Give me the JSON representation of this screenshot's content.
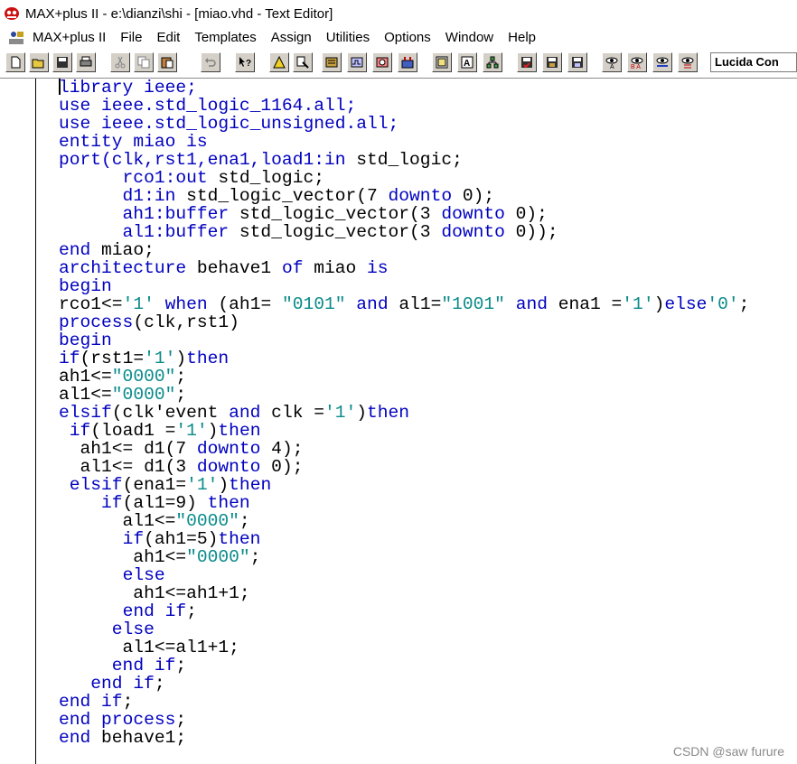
{
  "window": {
    "title": "MAX+plus II - e:\\dianzi\\shi - [miao.vhd - Text Editor]"
  },
  "menu": [
    "MAX+plus II",
    "File",
    "Edit",
    "Templates",
    "Assign",
    "Utilities",
    "Options",
    "Window",
    "Help"
  ],
  "toolbar": {
    "buttons": [
      "new-icon",
      "open-icon",
      "save-icon",
      "print-icon",
      "cut-icon",
      "copy-icon",
      "paste-icon",
      "undo-icon",
      "help-pointer-icon",
      "warning-icon",
      "hierarchy-icon",
      "compile-icon",
      "simulate-icon",
      "timing-icon",
      "program-icon",
      "floorplan-icon",
      "project-icon",
      "top-level-icon",
      "symbol-icon",
      "save-check-icon",
      "save-compile-icon",
      "save-simulate-icon",
      "find-icon",
      "replace-icon",
      "find-next-icon",
      "find-prev-icon"
    ],
    "font": "Lucida Con"
  },
  "editor": {
    "lines": [
      [
        {
          "t": "library ieee;",
          "c": "kw"
        }
      ],
      [
        {
          "t": "use",
          "c": "kw"
        },
        {
          "t": " ieee.std_logic_1164.",
          "c": "kw"
        },
        {
          "t": "all",
          "c": "kw"
        },
        {
          "t": ";",
          "c": "kw"
        }
      ],
      [
        {
          "t": "use",
          "c": "kw"
        },
        {
          "t": " ieee.std_logic_unsigned.",
          "c": "kw"
        },
        {
          "t": "all",
          "c": "kw"
        },
        {
          "t": ";",
          "c": "kw"
        }
      ],
      [
        {
          "t": "entity",
          "c": "kw"
        },
        {
          "t": " miao ",
          "c": "kw"
        },
        {
          "t": "is",
          "c": "kw"
        }
      ],
      [
        {
          "t": "port",
          "c": "kw"
        },
        {
          "t": "(clk,rst1,ena1,load1:",
          "c": "kw"
        },
        {
          "t": "in",
          "c": "kw"
        },
        {
          "t": " std_logic;",
          "c": ""
        }
      ],
      [
        {
          "t": "      rco1:",
          "c": "kw"
        },
        {
          "t": "out",
          "c": "kw"
        },
        {
          "t": " std_logic;",
          "c": ""
        }
      ],
      [
        {
          "t": "      d1:",
          "c": "kw"
        },
        {
          "t": "in",
          "c": "kw"
        },
        {
          "t": " std_logic_vector(7 ",
          "c": ""
        },
        {
          "t": "downto",
          "c": "kw"
        },
        {
          "t": " 0);",
          "c": ""
        }
      ],
      [
        {
          "t": "      ah1:",
          "c": "kw"
        },
        {
          "t": "buffer",
          "c": "kw"
        },
        {
          "t": " std_logic_vector(3 ",
          "c": ""
        },
        {
          "t": "downto",
          "c": "kw"
        },
        {
          "t": " 0);",
          "c": ""
        }
      ],
      [
        {
          "t": "      al1:",
          "c": "kw"
        },
        {
          "t": "buffer",
          "c": "kw"
        },
        {
          "t": " std_logic_vector(3 ",
          "c": ""
        },
        {
          "t": "downto",
          "c": "kw"
        },
        {
          "t": " 0));",
          "c": ""
        }
      ],
      [
        {
          "t": "end",
          "c": "kw"
        },
        {
          "t": " miao;",
          "c": ""
        }
      ],
      [
        {
          "t": "architecture",
          "c": "kw"
        },
        {
          "t": " behave1 ",
          "c": ""
        },
        {
          "t": "of",
          "c": "kw"
        },
        {
          "t": " miao ",
          "c": ""
        },
        {
          "t": "is",
          "c": "kw"
        }
      ],
      [
        {
          "t": "begin",
          "c": "kw"
        }
      ],
      [
        {
          "t": "rco1<=",
          "c": ""
        },
        {
          "t": "'1'",
          "c": "str"
        },
        {
          "t": " ",
          "c": ""
        },
        {
          "t": "when",
          "c": "kw"
        },
        {
          "t": " (ah1= ",
          "c": ""
        },
        {
          "t": "\"0101\"",
          "c": "str"
        },
        {
          "t": " ",
          "c": ""
        },
        {
          "t": "and",
          "c": "kw"
        },
        {
          "t": " al1=",
          "c": ""
        },
        {
          "t": "\"1001\"",
          "c": "str"
        },
        {
          "t": " ",
          "c": ""
        },
        {
          "t": "and",
          "c": "kw"
        },
        {
          "t": " ena1 =",
          "c": ""
        },
        {
          "t": "'1'",
          "c": "str"
        },
        {
          "t": ")",
          "c": ""
        },
        {
          "t": "else",
          "c": "kw"
        },
        {
          "t": "'0'",
          "c": "str"
        },
        {
          "t": ";",
          "c": ""
        }
      ],
      [
        {
          "t": "process",
          "c": "kw"
        },
        {
          "t": "(clk,rst1)",
          "c": ""
        }
      ],
      [
        {
          "t": "begin",
          "c": "kw"
        }
      ],
      [
        {
          "t": "if",
          "c": "kw"
        },
        {
          "t": "(rst1=",
          "c": ""
        },
        {
          "t": "'1'",
          "c": "str"
        },
        {
          "t": ")",
          "c": ""
        },
        {
          "t": "then",
          "c": "kw"
        }
      ],
      [
        {
          "t": "ah1<=",
          "c": ""
        },
        {
          "t": "\"0000\"",
          "c": "str"
        },
        {
          "t": ";",
          "c": ""
        }
      ],
      [
        {
          "t": "al1<=",
          "c": ""
        },
        {
          "t": "\"0000\"",
          "c": "str"
        },
        {
          "t": ";",
          "c": ""
        }
      ],
      [
        {
          "t": "elsif",
          "c": "kw"
        },
        {
          "t": "(clk'event ",
          "c": ""
        },
        {
          "t": "and",
          "c": "kw"
        },
        {
          "t": " clk =",
          "c": ""
        },
        {
          "t": "'1'",
          "c": "str"
        },
        {
          "t": ")",
          "c": ""
        },
        {
          "t": "then",
          "c": "kw"
        }
      ],
      [
        {
          "t": " ",
          "c": ""
        },
        {
          "t": "if",
          "c": "kw"
        },
        {
          "t": "(load1 =",
          "c": ""
        },
        {
          "t": "'1'",
          "c": "str"
        },
        {
          "t": ")",
          "c": ""
        },
        {
          "t": "then",
          "c": "kw"
        }
      ],
      [
        {
          "t": "  ah1<= d1(7 ",
          "c": ""
        },
        {
          "t": "downto",
          "c": "kw"
        },
        {
          "t": " 4);",
          "c": ""
        }
      ],
      [
        {
          "t": "  al1<= d1(3 ",
          "c": ""
        },
        {
          "t": "downto",
          "c": "kw"
        },
        {
          "t": " 0);",
          "c": ""
        }
      ],
      [
        {
          "t": " ",
          "c": ""
        },
        {
          "t": "elsif",
          "c": "kw"
        },
        {
          "t": "(ena1=",
          "c": ""
        },
        {
          "t": "'1'",
          "c": "str"
        },
        {
          "t": ")",
          "c": ""
        },
        {
          "t": "then",
          "c": "kw"
        }
      ],
      [
        {
          "t": "    ",
          "c": ""
        },
        {
          "t": "if",
          "c": "kw"
        },
        {
          "t": "(al1=9) ",
          "c": ""
        },
        {
          "t": "then",
          "c": "kw"
        }
      ],
      [
        {
          "t": "      al1<=",
          "c": ""
        },
        {
          "t": "\"0000\"",
          "c": "str"
        },
        {
          "t": ";",
          "c": ""
        }
      ],
      [
        {
          "t": "      ",
          "c": ""
        },
        {
          "t": "if",
          "c": "kw"
        },
        {
          "t": "(ah1=5)",
          "c": ""
        },
        {
          "t": "then",
          "c": "kw"
        }
      ],
      [
        {
          "t": "       ah1<=",
          "c": ""
        },
        {
          "t": "\"0000\"",
          "c": "str"
        },
        {
          "t": ";",
          "c": ""
        }
      ],
      [
        {
          "t": "      ",
          "c": ""
        },
        {
          "t": "else",
          "c": "kw"
        }
      ],
      [
        {
          "t": "       ah1<=ah1+1;",
          "c": ""
        }
      ],
      [
        {
          "t": "      ",
          "c": ""
        },
        {
          "t": "end",
          "c": "kw"
        },
        {
          "t": " ",
          "c": ""
        },
        {
          "t": "if",
          "c": "kw"
        },
        {
          "t": ";",
          "c": ""
        }
      ],
      [
        {
          "t": "     ",
          "c": ""
        },
        {
          "t": "else",
          "c": "kw"
        }
      ],
      [
        {
          "t": "      al1<=al1+1;",
          "c": ""
        }
      ],
      [
        {
          "t": "     ",
          "c": ""
        },
        {
          "t": "end",
          "c": "kw"
        },
        {
          "t": " ",
          "c": ""
        },
        {
          "t": "if",
          "c": "kw"
        },
        {
          "t": ";",
          "c": ""
        }
      ],
      [
        {
          "t": "   ",
          "c": ""
        },
        {
          "t": "end",
          "c": "kw"
        },
        {
          "t": " ",
          "c": ""
        },
        {
          "t": "if",
          "c": "kw"
        },
        {
          "t": ";",
          "c": ""
        }
      ],
      [
        {
          "t": "end",
          "c": "kw"
        },
        {
          "t": " ",
          "c": ""
        },
        {
          "t": "if",
          "c": "kw"
        },
        {
          "t": ";",
          "c": ""
        }
      ],
      [
        {
          "t": "end",
          "c": "kw"
        },
        {
          "t": " ",
          "c": ""
        },
        {
          "t": "process",
          "c": "kw"
        },
        {
          "t": ";",
          "c": ""
        }
      ],
      [
        {
          "t": "end",
          "c": "kw"
        },
        {
          "t": " behave1;",
          "c": ""
        }
      ]
    ]
  },
  "watermark": "CSDN @saw furure"
}
